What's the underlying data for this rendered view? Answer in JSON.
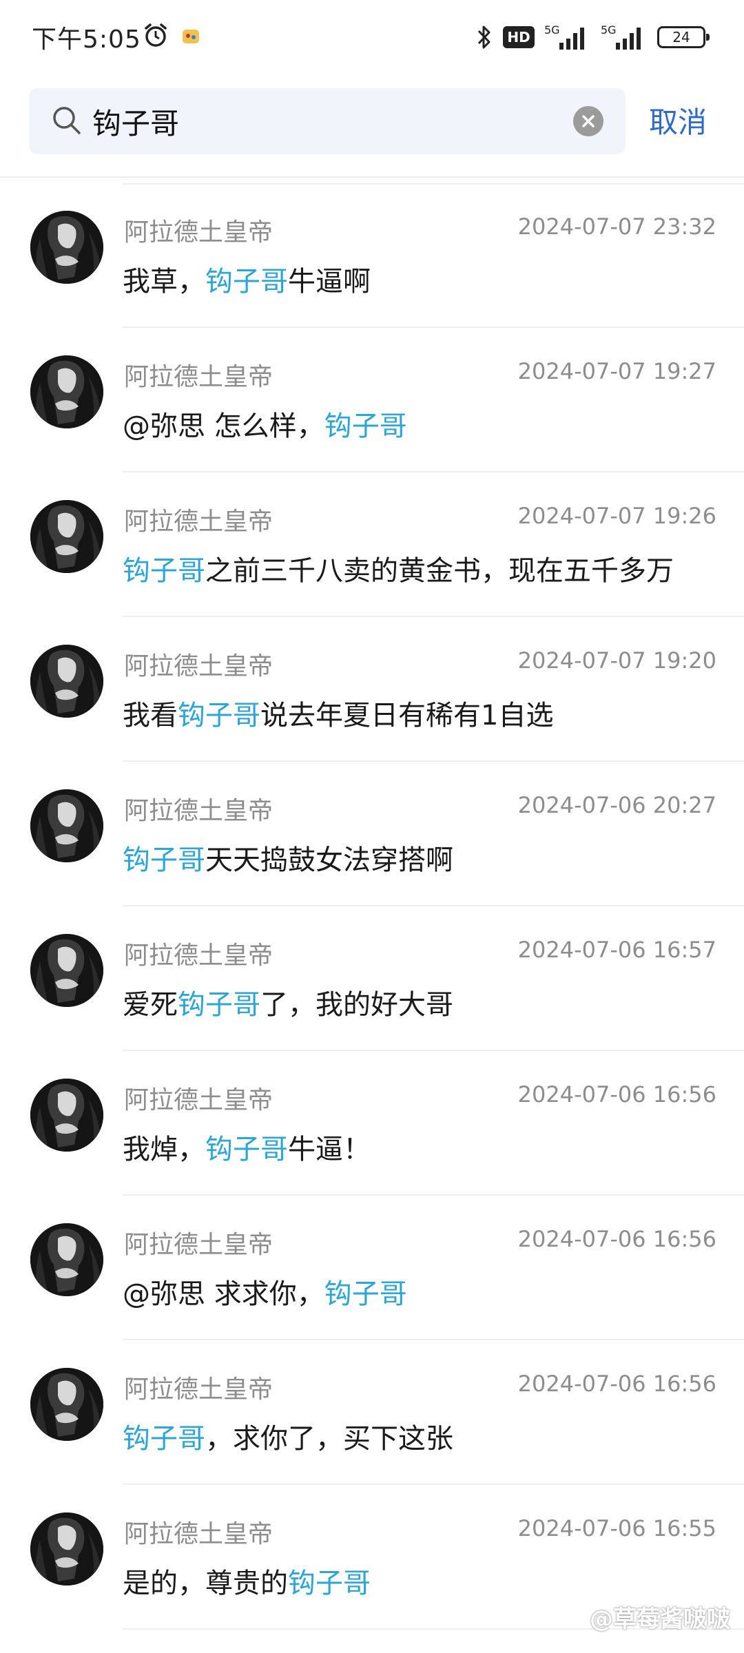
{
  "status_bar": {
    "time": "下午5:05",
    "network_label_1": "5G",
    "network_label_2": "5G",
    "hd_label": "HD",
    "battery": "24",
    "icons": [
      "alarm-icon",
      "app-notification-icon",
      "bluetooth-icon",
      "hd-voice-icon",
      "signal-icon",
      "signal-icon",
      "battery-icon"
    ]
  },
  "search": {
    "value": "钩子哥",
    "cancel_label": "取消",
    "search_icon": "search-icon",
    "clear_icon": "clear-icon"
  },
  "accent_color": "#2aa6d8",
  "cancel_color": "#2e6bc8",
  "results": [
    {
      "sender": "阿拉德土皇帝",
      "time": "2024-07-07 23:32",
      "parts": [
        [
          "我草，",
          false
        ],
        [
          "钩子哥",
          true
        ],
        [
          "牛逼啊",
          false
        ]
      ]
    },
    {
      "sender": "阿拉德土皇帝",
      "time": "2024-07-07 19:27",
      "parts": [
        [
          "@弥思  怎么样，",
          false
        ],
        [
          "钩子哥",
          true
        ]
      ]
    },
    {
      "sender": "阿拉德土皇帝",
      "time": "2024-07-07 19:26",
      "parts": [
        [
          "钩子哥",
          true
        ],
        [
          "之前三千八卖的黄金书，现在五千多万",
          false
        ]
      ]
    },
    {
      "sender": "阿拉德土皇帝",
      "time": "2024-07-07 19:20",
      "parts": [
        [
          "我看",
          false
        ],
        [
          "钩子哥",
          true
        ],
        [
          "说去年夏日有稀有1自选",
          false
        ]
      ]
    },
    {
      "sender": "阿拉德土皇帝",
      "time": "2024-07-06 20:27",
      "parts": [
        [
          "钩子哥",
          true
        ],
        [
          "天天捣鼓女法穿搭啊",
          false
        ]
      ]
    },
    {
      "sender": "阿拉德土皇帝",
      "time": "2024-07-06 16:57",
      "parts": [
        [
          "爱死",
          false
        ],
        [
          "钩子哥",
          true
        ],
        [
          "了，我的好大哥",
          false
        ]
      ]
    },
    {
      "sender": "阿拉德土皇帝",
      "time": "2024-07-06 16:56",
      "parts": [
        [
          "我焯，",
          false
        ],
        [
          "钩子哥",
          true
        ],
        [
          "牛逼！",
          false
        ]
      ]
    },
    {
      "sender": "阿拉德土皇帝",
      "time": "2024-07-06 16:56",
      "parts": [
        [
          "@弥思  求求你，",
          false
        ],
        [
          "钩子哥",
          true
        ]
      ]
    },
    {
      "sender": "阿拉德土皇帝",
      "time": "2024-07-06 16:56",
      "parts": [
        [
          "钩子哥",
          true
        ],
        [
          "，求你了，买下这张",
          false
        ]
      ]
    },
    {
      "sender": "阿拉德土皇帝",
      "time": "2024-07-06 16:55",
      "parts": [
        [
          "是的，尊贵的",
          false
        ],
        [
          "钩子哥",
          true
        ]
      ]
    }
  ],
  "watermark": "@草莓酱啵啵"
}
